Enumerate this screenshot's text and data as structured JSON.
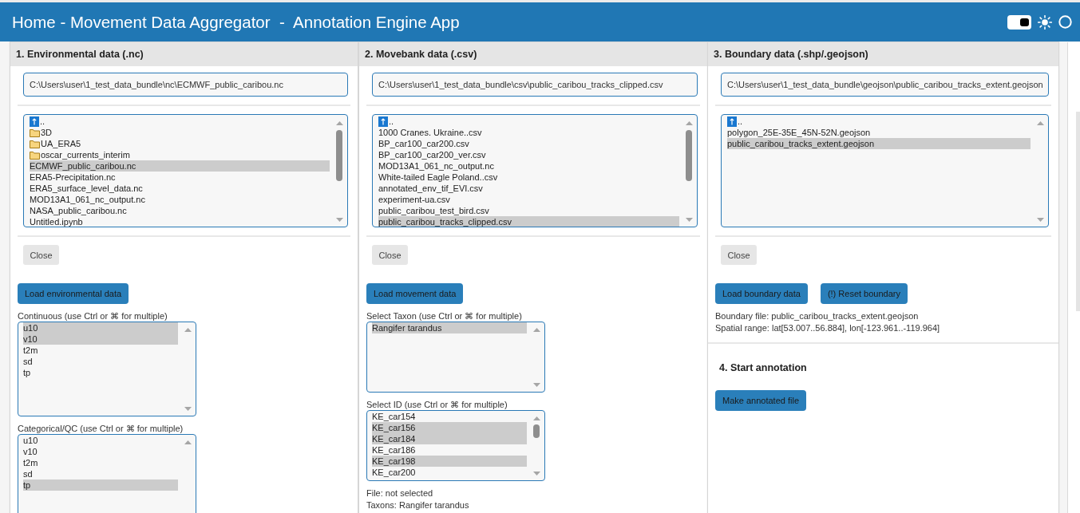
{
  "header": {
    "title": "Home - Movement Data Aggregator  -  Annotation Engine App",
    "theme_toggle": {
      "on": true
    }
  },
  "panels": [
    {
      "title": "1. Environmental data (.nc)",
      "path": "C:\\Users\\user\\1_test_data_bundle\\nc\\ECMWF_public_caribou.nc",
      "files": [
        {
          "kind": "parent",
          "label": "..",
          "selected": false
        },
        {
          "kind": "folder",
          "label": "3D",
          "selected": false
        },
        {
          "kind": "folder",
          "label": "UA_ERA5",
          "selected": false
        },
        {
          "kind": "folder",
          "label": "oscar_currents_interim",
          "selected": false
        },
        {
          "kind": "file",
          "label": "ECMWF_public_caribou.nc",
          "selected": true
        },
        {
          "kind": "file",
          "label": "ERA5-Precipitation.nc",
          "selected": false
        },
        {
          "kind": "file",
          "label": "ERA5_surface_level_data.nc",
          "selected": false
        },
        {
          "kind": "file",
          "label": "MOD13A1_061_nc_output.nc",
          "selected": false
        },
        {
          "kind": "file",
          "label": "NASA_public_caribou.nc",
          "selected": false
        },
        {
          "kind": "file",
          "label": "Untitled.ipynb",
          "selected": false
        }
      ],
      "close": "Close",
      "actions": [
        "Load environmental data"
      ],
      "selects": [
        {
          "label": "Continuous (use Ctrl or ⌘ for multiple)",
          "options": [
            {
              "label": "u10",
              "selected": true
            },
            {
              "label": "v10",
              "selected": true
            },
            {
              "label": "t2m",
              "selected": false
            },
            {
              "label": "sd",
              "selected": false
            },
            {
              "label": "tp",
              "selected": false
            }
          ]
        },
        {
          "label": "Categorical/QC (use Ctrl or ⌘ for multiple)",
          "options": [
            {
              "label": "u10",
              "selected": false
            },
            {
              "label": "v10",
              "selected": false
            },
            {
              "label": "t2m",
              "selected": false
            },
            {
              "label": "sd",
              "selected": false
            },
            {
              "label": "tp",
              "selected": true
            }
          ]
        }
      ]
    },
    {
      "title": "2. Movebank data (.csv)",
      "path": "C:\\Users\\user\\1_test_data_bundle\\csv\\public_caribou_tracks_clipped.csv",
      "files": [
        {
          "kind": "parent",
          "label": "..",
          "selected": false
        },
        {
          "kind": "file",
          "label": "1000 Cranes. Ukraine..csv",
          "selected": false
        },
        {
          "kind": "file",
          "label": "BP_car100_car200.csv",
          "selected": false
        },
        {
          "kind": "file",
          "label": "BP_car100_car200_ver.csv",
          "selected": false
        },
        {
          "kind": "file",
          "label": "MOD13A1_061_nc_output.nc",
          "selected": false
        },
        {
          "kind": "file",
          "label": "White-tailed Eagle Poland..csv",
          "selected": false
        },
        {
          "kind": "file",
          "label": "annotated_env_tif_EVI.csv",
          "selected": false
        },
        {
          "kind": "file",
          "label": "experiment-ua.csv",
          "selected": false
        },
        {
          "kind": "file",
          "label": "public_caribou_test_bird.csv",
          "selected": false
        },
        {
          "kind": "file",
          "label": "public_caribou_tracks_clipped.csv",
          "selected": true
        }
      ],
      "close": "Close",
      "actions": [
        "Load movement data"
      ],
      "selects": [
        {
          "label": "Select Taxon (use Ctrl or ⌘ for multiple)",
          "options": [
            {
              "label": "Rangifer tarandus",
              "selected": true
            }
          ]
        },
        {
          "label": "Select ID (use Ctrl or ⌘ for multiple)",
          "options": [
            {
              "label": "KE_car154",
              "selected": false
            },
            {
              "label": "KE_car156",
              "selected": true
            },
            {
              "label": "KE_car184",
              "selected": true
            },
            {
              "label": "KE_car186",
              "selected": false
            },
            {
              "label": "KE_car198",
              "selected": true
            },
            {
              "label": "KE_car200",
              "selected": false
            }
          ]
        }
      ],
      "notes": [
        "File: not selected",
        "Taxons: Rangifer tarandus"
      ]
    },
    {
      "title": "3. Boundary data (.shp/.geojson)",
      "path": "C:\\Users\\user\\1_test_data_bundle\\geojson\\public_caribou_tracks_extent.geojson",
      "files": [
        {
          "kind": "parent",
          "label": "..",
          "selected": false
        },
        {
          "kind": "file",
          "label": "polygon_25E-35E_45N-52N.geojson",
          "selected": false
        },
        {
          "kind": "file",
          "label": "public_caribou_tracks_extent.geojson",
          "selected": true
        }
      ],
      "close": "Close",
      "actions": [
        "Load boundary data",
        "(!) Reset boundary"
      ],
      "notes": [
        "Boundary file: public_caribou_tracks_extent.geojson",
        "Spatial range: lat[53.007..56.884], lon[-123.961..-119.964]"
      ],
      "next_step": {
        "title": "4. Start annotation",
        "button": "Make annotated file"
      }
    }
  ]
}
